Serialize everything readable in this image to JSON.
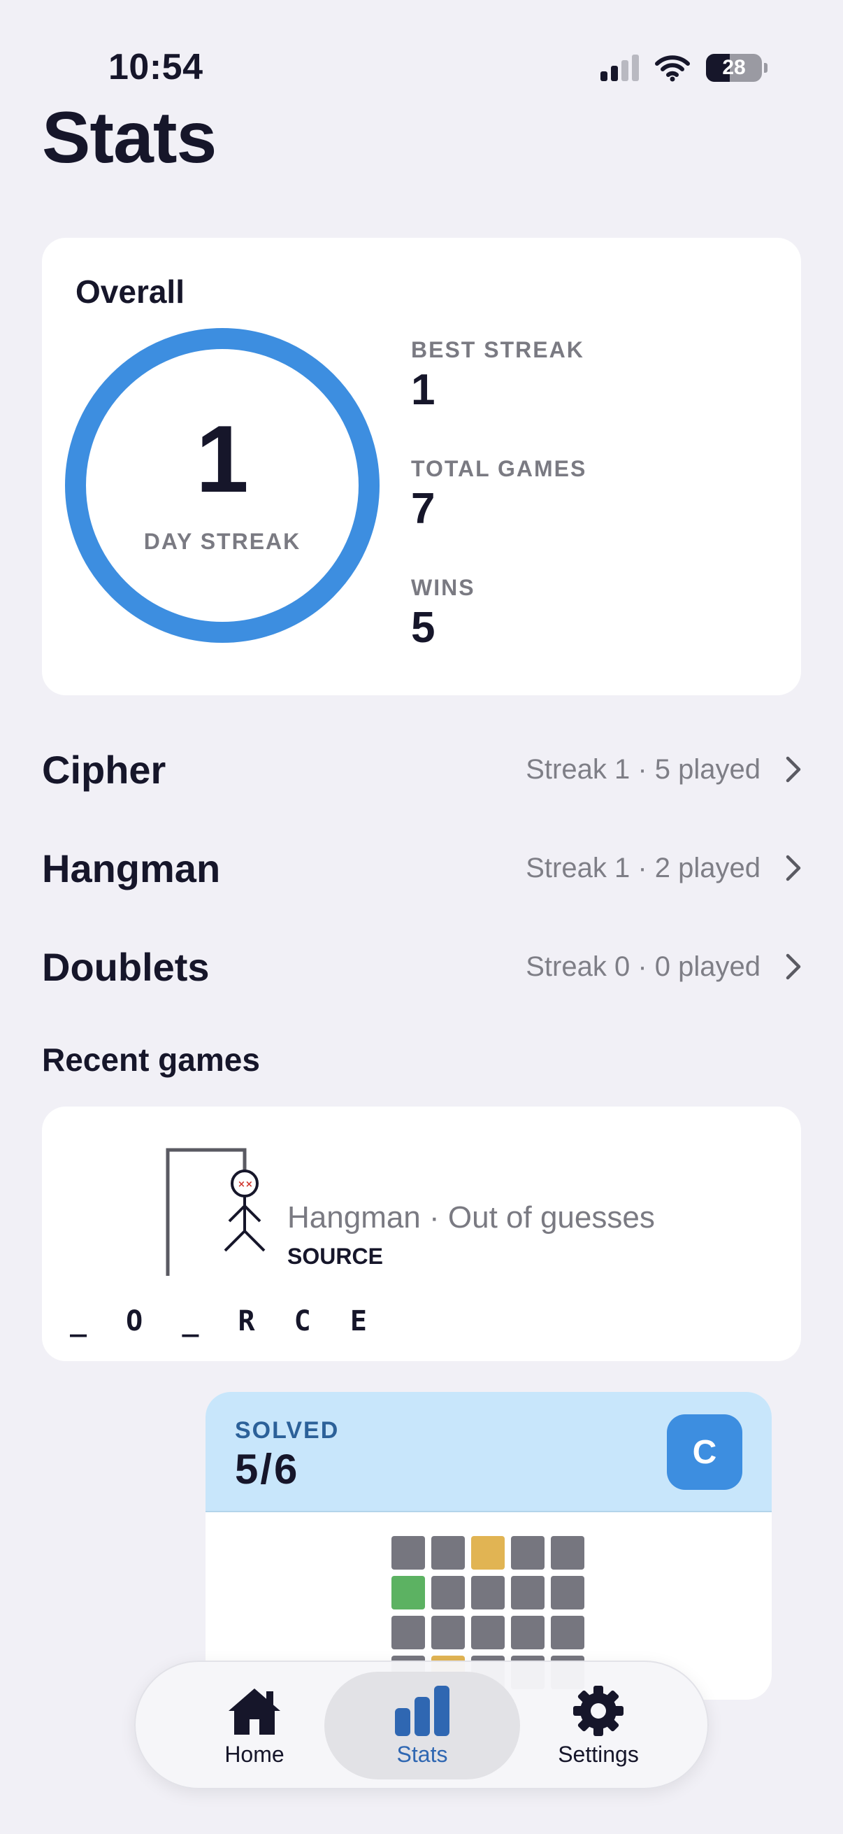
{
  "status_bar": {
    "time": "10:54",
    "battery": "28"
  },
  "page_title": "Stats",
  "overall": {
    "title": "Overall",
    "streak_value": "1",
    "streak_label": "DAY STREAK",
    "stats": [
      {
        "label": "BEST STREAK",
        "value": "1"
      },
      {
        "label": "TOTAL GAMES",
        "value": "7"
      },
      {
        "label": "WINS",
        "value": "5"
      }
    ]
  },
  "games": [
    {
      "name": "Cipher",
      "meta": "Streak 1 · 5 played"
    },
    {
      "name": "Hangman",
      "meta": "Streak 1 · 2 played"
    },
    {
      "name": "Doublets",
      "meta": "Streak 0 · 0 played"
    }
  ],
  "recent": {
    "title": "Recent games",
    "hangman": {
      "summary": "Hangman · Out of guesses",
      "word": "SOURCE",
      "revealed": "_ O _ R C E"
    },
    "cipher": {
      "status": "SOLVED",
      "score": "5/6",
      "badge": "C",
      "grid": [
        [
          "gray",
          "gray",
          "yellow",
          "gray",
          "gray"
        ],
        [
          "green",
          "gray",
          "gray",
          "gray",
          "gray"
        ],
        [
          "gray",
          "gray",
          "gray",
          "gray",
          "gray"
        ],
        [
          "gray",
          "yellow",
          "gray",
          "gray",
          "gray"
        ]
      ]
    }
  },
  "colors": {
    "ring": "#3d8ee0",
    "tile_gray": "#76767f",
    "tile_yellow": "#e1b453",
    "tile_green": "#5cb262",
    "accent_tab": "#2f67b2"
  },
  "tabbar": {
    "tabs": [
      {
        "label": "Home",
        "icon": "home-icon",
        "active": false
      },
      {
        "label": "Stats",
        "icon": "bar-chart-icon",
        "active": true
      },
      {
        "label": "Settings",
        "icon": "gear-icon",
        "active": false
      }
    ]
  }
}
